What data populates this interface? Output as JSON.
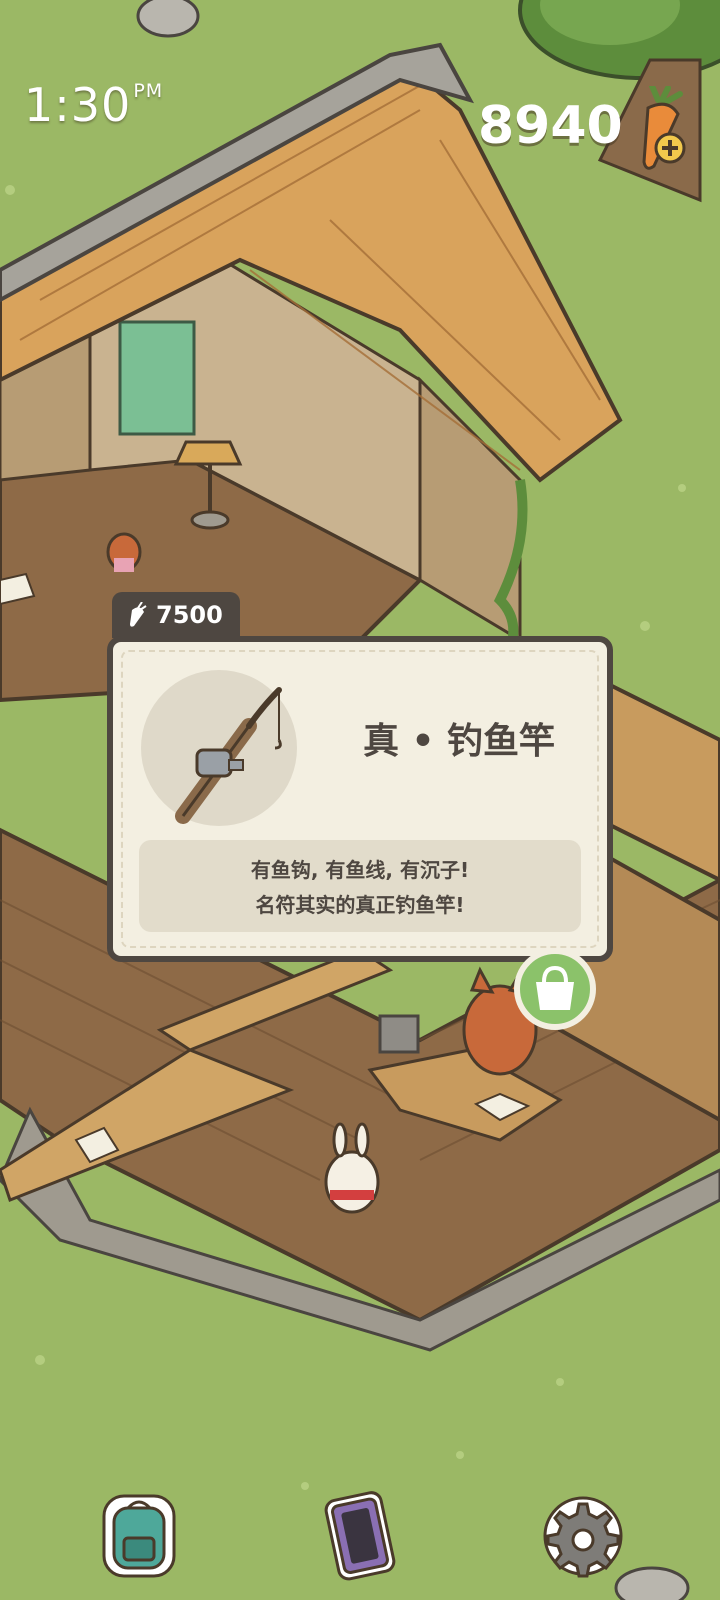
{
  "status": {
    "time": "1:30",
    "ampm": "PM"
  },
  "currency": {
    "amount": "8940",
    "icon": "carrot-icon",
    "add_icon": "plus-icon"
  },
  "item_card": {
    "price": "7500",
    "price_icon": "carrot-icon",
    "name": "真 • 钓鱼竿",
    "icon": "fishing-rod-icon",
    "description": [
      "有鱼钩, 有鱼线, 有沉子!",
      "名符其实的真正钓鱼竿!"
    ]
  },
  "shop_bubble": {
    "icon": "shopping-bag-icon"
  },
  "bottom_bar": {
    "buttons": [
      "backpack-icon",
      "phone-icon",
      "gear-icon"
    ]
  },
  "colors": {
    "grass": "#9bb865",
    "card_border": "#4e4741",
    "card_bg": "#f3efe1",
    "shop_green": "#8bc26a"
  }
}
